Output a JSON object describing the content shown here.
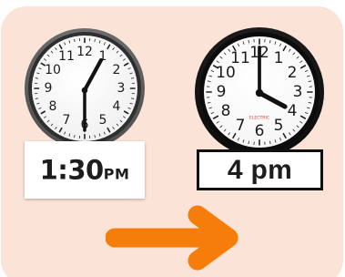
{
  "clocks": {
    "left": {
      "numerals": [
        "12",
        "1",
        "2",
        "3",
        "4",
        "5",
        "6",
        "7",
        "8",
        "9",
        "10",
        "11"
      ],
      "label": {
        "main": "1:30",
        "suffix": "PM"
      },
      "face_color": "#f7f7f7",
      "frame_color": "#606060"
    },
    "right": {
      "numerals": [
        "12",
        "1",
        "2",
        "3",
        "4",
        "5",
        "6",
        "7",
        "8",
        "9",
        "10",
        "11"
      ],
      "brand": "ELECTRIC",
      "label": {
        "main": "4 pm"
      },
      "face_color": "#ffffff",
      "frame_color": "#121212",
      "brand_color": "#d9352f"
    }
  },
  "arrow": {
    "color": "#f77d0a"
  },
  "colors": {
    "background": "#fbe3d7"
  }
}
